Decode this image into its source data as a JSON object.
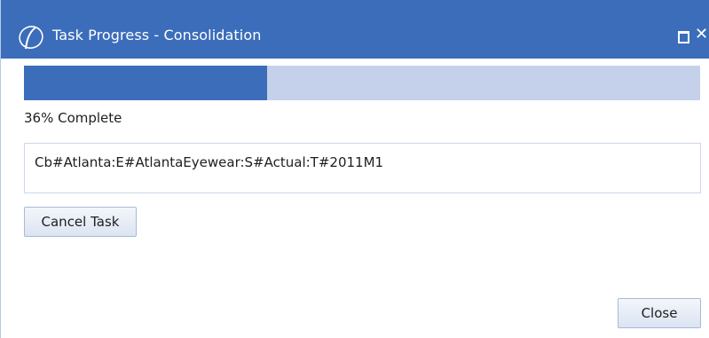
{
  "window": {
    "title": "Task Progress - Consolidation",
    "logo_icon": "app-logo-icon",
    "maximize_icon": "maximize-icon",
    "close_icon": "close-icon",
    "close_glyph": "✕"
  },
  "progress": {
    "fraction": 0.36,
    "status_text": "36% Complete",
    "task_detail": "Cb#Atlanta:E#AtlantaEyewear:S#Actual:T#2011M1"
  },
  "buttons": {
    "cancel_label": "Cancel Task",
    "close_label": "Close"
  },
  "colors": {
    "titlebar": "#3b6dbb",
    "progress_fill": "#3b6dbb",
    "progress_track": "#c5d1ea"
  }
}
